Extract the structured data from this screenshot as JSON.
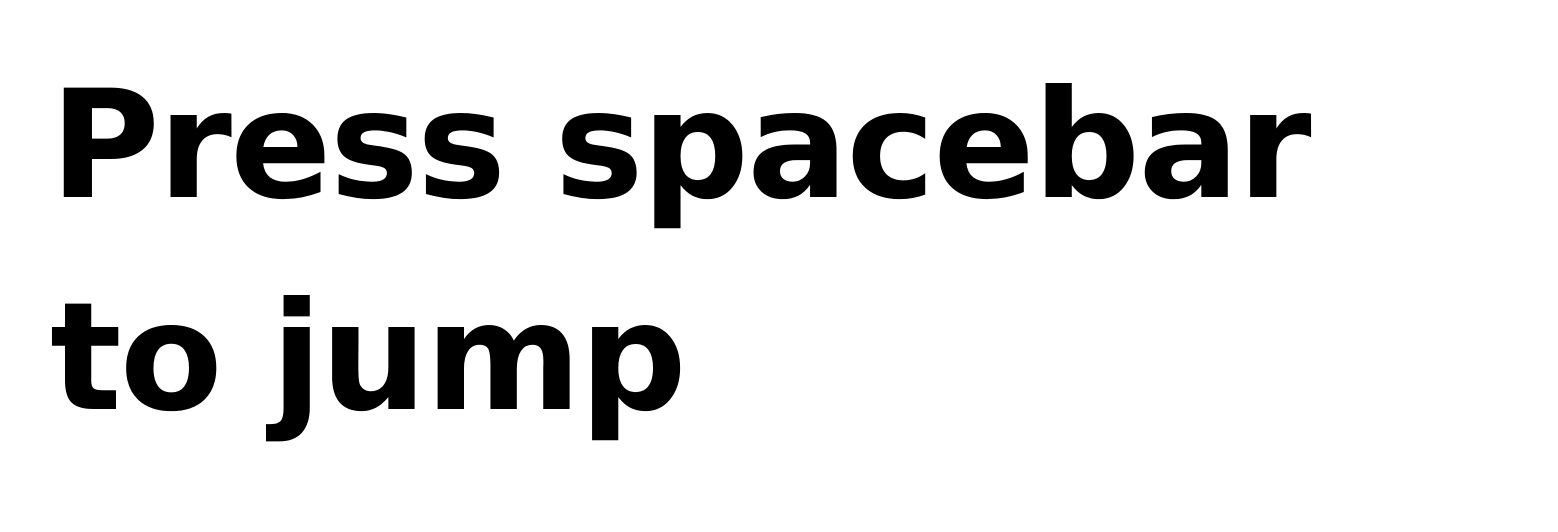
{
  "instruction": {
    "line1": "Press spacebar",
    "line2": "to jump"
  },
  "colors": {
    "background": "#ffffff",
    "text": "#000000"
  }
}
